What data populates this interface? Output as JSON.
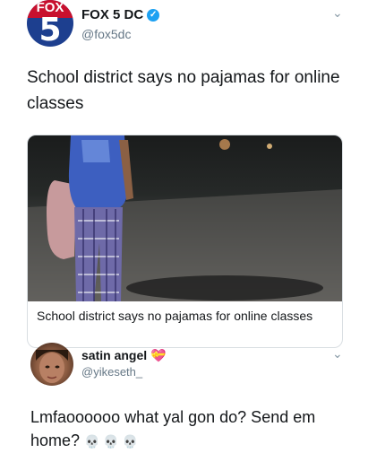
{
  "tweet1": {
    "display_name": "FOX 5 DC",
    "handle": "@fox5dc",
    "text": "School district says no pajamas for online classes",
    "avatar_top": "FOX",
    "avatar_num": "5"
  },
  "card": {
    "title": "School district says no pajamas for online classes"
  },
  "tweet2": {
    "display_name": "satin angel",
    "badge_emoji": "💝",
    "handle": "@yikeseth_",
    "text": "Lmfaoooooo what yal gon do? Send em home?",
    "emojis": "💀 💀 💀"
  },
  "icons": {
    "verified": "verified-check-icon",
    "menu": "chevron-down-icon"
  },
  "colors": {
    "verified": "#1da1f2",
    "handle": "#657786",
    "fox_red": "#c8102e",
    "fox_blue": "#1d3f8f"
  }
}
